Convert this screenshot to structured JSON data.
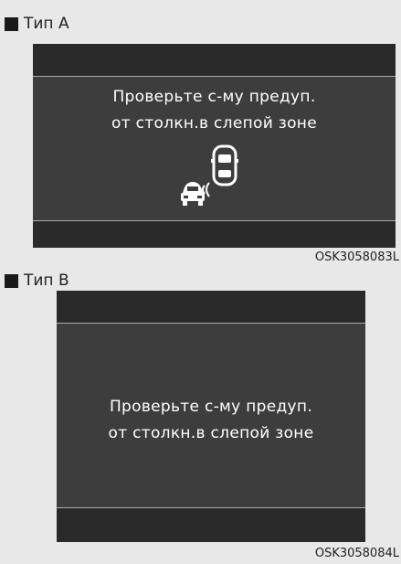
{
  "type_a": {
    "label": "Тип А",
    "message_line1": "Проверьте с-му предуп.",
    "message_line2": "от столкн.в слепой зоне",
    "code": "OSK3058083L"
  },
  "type_b": {
    "label": "Тип B",
    "message_line1": "Проверьте с-му предуп.",
    "message_line2": "от столкн.в слепой зоне",
    "code": "OSK3058084L"
  },
  "colors": {
    "panel_bg": "#e8e8e8",
    "screen_bg": "#3d3d3d",
    "bar_bg": "#2a2a2a",
    "text": "#ffffff"
  },
  "icons": [
    "square-bullet-icon",
    "blind-spot-cars-icon"
  ]
}
